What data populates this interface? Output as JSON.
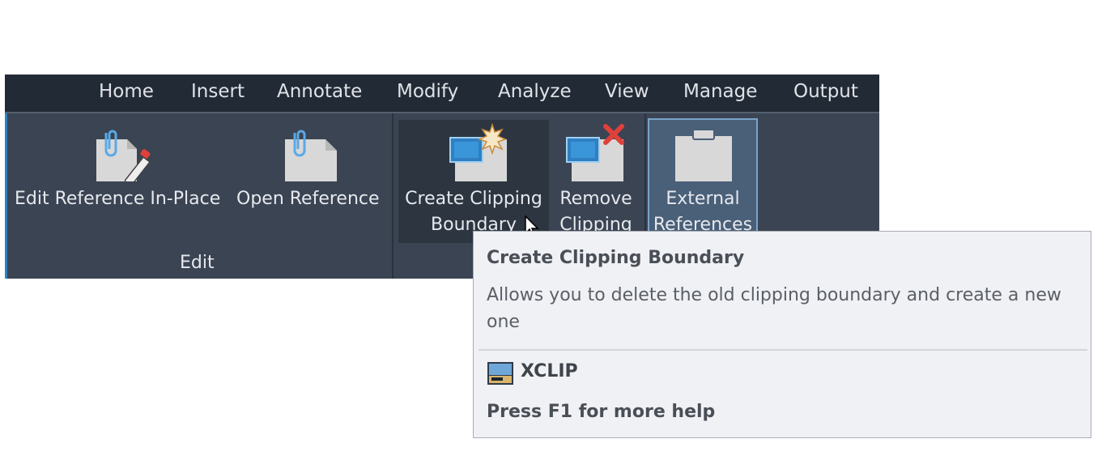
{
  "ribbon": {
    "tabs": [
      "Home",
      "Insert",
      "Annotate",
      "Modify",
      "Analyze",
      "View",
      "Manage",
      "Output"
    ],
    "edit_panel": {
      "title": "Edit",
      "buttons": [
        {
          "label": "Edit Reference In-Place",
          "icon": "paperclip-document-pencil-icon"
        },
        {
          "label": "Open Reference",
          "icon": "paperclip-document-icon"
        }
      ]
    },
    "clip_panel": {
      "buttons": [
        {
          "label_line1": "Create Clipping",
          "label_line2": "Boundary",
          "icon": "create-clip-boundary-icon"
        },
        {
          "label_line1": "Remove",
          "label_line2": "Clipping",
          "icon": "remove-clip-icon"
        },
        {
          "label_line1": "External",
          "label_line2": "References",
          "icon": "clipboard-icon"
        }
      ]
    }
  },
  "tooltip": {
    "title": "Create Clipping Boundary",
    "description": "Allows you to delete the old clipping boundary and create a new one",
    "command": "XCLIP",
    "help": "Press F1 for more help"
  },
  "colors": {
    "ribbon_bg": "#3b4453",
    "tabbar_bg": "#222a35",
    "tooltip_bg": "#f0f1f4",
    "accent": "#2a84c3",
    "delete_red": "#e0403a"
  }
}
